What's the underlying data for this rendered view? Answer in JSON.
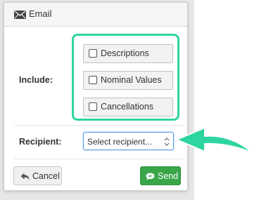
{
  "dialog": {
    "title": "Email",
    "header_icon": "envelope-icon"
  },
  "include": {
    "label": "Include:",
    "options": [
      {
        "label": "Descriptions",
        "checked": false
      },
      {
        "label": "Nominal Values",
        "checked": false
      },
      {
        "label": "Cancellations",
        "checked": false
      }
    ]
  },
  "recipient": {
    "label": "Recipient:",
    "selected": "Select recipient..."
  },
  "footer": {
    "cancel_label": "Cancel",
    "cancel_icon": "reply-icon",
    "send_label": "Send",
    "send_icon": "chat-bubble-icon"
  },
  "annotation": {
    "highlight_color": "#2ed5a1",
    "arrow_color": "#2ed5a1"
  },
  "colors": {
    "send_button": "#3aa64a",
    "select_focus_border": "#5b9ee8"
  }
}
